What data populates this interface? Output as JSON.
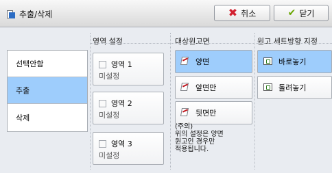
{
  "window": {
    "title": "추출/삭제",
    "cancel_label": "취소",
    "close_label": "닫기"
  },
  "left_menu": {
    "items": [
      "선택안함",
      "추출",
      "삭제"
    ],
    "selected_index": 1
  },
  "sections": {
    "area_setting": "영역 설정",
    "target_doc_side": "대상원고면",
    "orientation": "원고 세트방향 지정"
  },
  "areas": [
    {
      "label": "영역 1",
      "status": "미설정"
    },
    {
      "label": "영역 2",
      "status": "미설정"
    },
    {
      "label": "영역 3",
      "status": "미설정"
    }
  ],
  "doc_side_options": [
    {
      "label": "양면",
      "selected": true
    },
    {
      "label": "앞면만",
      "selected": false
    },
    {
      "label": "뒷면만",
      "selected": false
    }
  ],
  "note": "(주의)\n위의 설정은 양면\n원고인 경우만\n적용됩니다.",
  "orientation_options": [
    {
      "label": "바로놓기",
      "selected": true
    },
    {
      "label": "돌려놓기",
      "selected": false
    }
  ]
}
